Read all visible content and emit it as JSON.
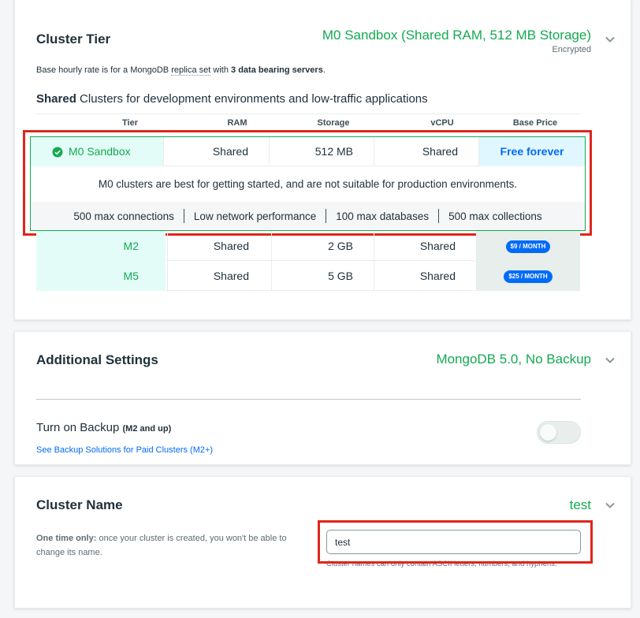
{
  "cluster_tier": {
    "title": "Cluster Tier",
    "summary": "M0 Sandbox (Shared RAM, 512 MB Storage)",
    "encrypted": "Encrypted",
    "rate_prefix": "Base hourly rate is for a MongoDB ",
    "rate_link": "replica set",
    "rate_mid": " with ",
    "rate_bold": "3 data bearing servers",
    "rate_suffix": ".",
    "shared_bold": "Shared",
    "shared_rest": " Clusters for development environments and low-traffic applications",
    "columns": [
      "Tier",
      "RAM",
      "Storage",
      "vCPU",
      "Base Price"
    ],
    "selected": {
      "tier": "M0 Sandbox",
      "ram": "Shared",
      "storage": "512 MB",
      "vcpu": "Shared",
      "price": "Free forever",
      "info": "M0 clusters are best for getting started, and are not suitable for production environments.",
      "limits": [
        "500 max connections",
        "Low network performance",
        "100 max databases",
        "500 max collections"
      ]
    },
    "rows": [
      {
        "tier": "M2",
        "ram": "Shared",
        "storage": "2 GB",
        "vcpu": "Shared",
        "price": "$9 / MONTH"
      },
      {
        "tier": "M5",
        "ram": "Shared",
        "storage": "5 GB",
        "vcpu": "Shared",
        "price": "$25 / MONTH"
      }
    ]
  },
  "additional_settings": {
    "title": "Additional Settings",
    "summary": "MongoDB 5.0, No Backup",
    "backup_label": "Turn on Backup",
    "backup_note": "(M2 and up)",
    "backup_link": "See Backup Solutions for Paid Clusters (M2+)",
    "backup_enabled": false
  },
  "cluster_name": {
    "title": "Cluster Name",
    "summary": "test",
    "note_bold": "One time only:",
    "note_rest": " once your cluster is created, you won't be able to change its name.",
    "input_value": "test",
    "hint": "Cluster names can only contain ASCII letters, numbers, and hyphens."
  },
  "colors": {
    "green": "#13aa52",
    "mint": "#e3fcf7",
    "blue": "#016bf8",
    "highlight": "#e0261b"
  }
}
